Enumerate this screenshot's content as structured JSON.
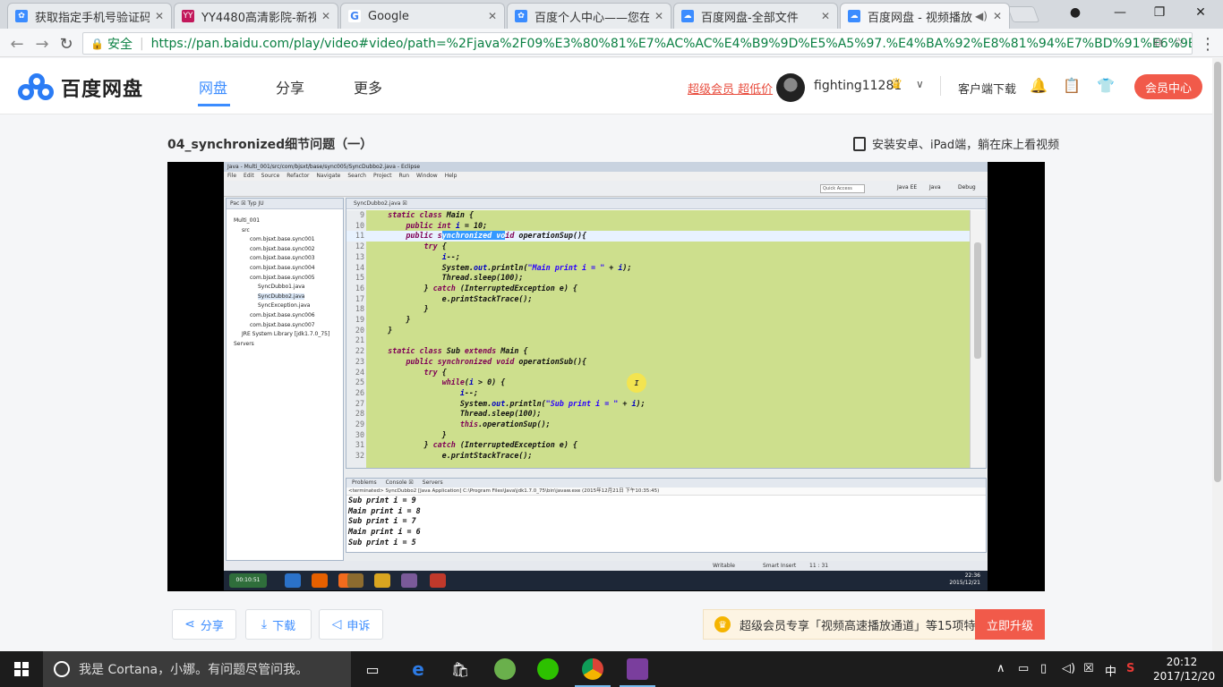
{
  "browser": {
    "tabs": [
      {
        "title": "获取指定手机号验证码",
        "icon_color": "#3b8cff",
        "icon": "baidu-paw-icon"
      },
      {
        "title": "YY4480高清影院-新视",
        "icon_color": "#c2185b",
        "icon": "yy4480-icon"
      },
      {
        "title": "Google",
        "icon_color": "#4285f4",
        "icon": "google-icon"
      },
      {
        "title": "百度个人中心——您在",
        "icon_color": "#3b8cff",
        "icon": "baidu-paw-icon"
      },
      {
        "title": "百度网盘-全部文件",
        "icon_color": "#3b8cff",
        "icon": "baidu-pan-icon"
      },
      {
        "title": "百度网盘 - 视频播放",
        "icon_color": "#3b8cff",
        "icon": "baidu-pan-icon",
        "active": true
      }
    ],
    "secure_label": "安全",
    "url_host": "https://pan.baidu.com",
    "url_rest": "/play/video#video/path=%2Fjava%2F09%E3%80%81%E7%AC%AC%E4%B9%9D%E5%A5%97.%E4%BA%92%E8%81%94%E7%BD%91%E6%9E..."
  },
  "header": {
    "logo_text": "百度网盘",
    "nav": [
      "网盘",
      "分享",
      "更多"
    ],
    "vip_link": "超级会员 超低价",
    "username": "fighting11281",
    "client_download": "客户端下载",
    "vip_center": "会员中心"
  },
  "video": {
    "title": "04_synchronized细节问题（一）",
    "mobile_hint": "安装安卓、iPad端，躺在床上看视频"
  },
  "eclipse": {
    "title_bar": "Java - Multi_001/src/com/bjsxt/base/sync005/SyncDubbo2.java - Eclipse",
    "menu": [
      "File",
      "Edit",
      "Source",
      "Refactor",
      "Navigate",
      "Search",
      "Project",
      "Run",
      "Window",
      "Help"
    ],
    "quick_access": "Quick Access",
    "perspectives": [
      "Java EE",
      "Java",
      "Debug"
    ],
    "pkg_tabs": "Pac ☒  Typ  JU",
    "tree": [
      {
        "label": "Multi_001",
        "indent": 0
      },
      {
        "label": "src",
        "indent": 1
      },
      {
        "label": "com.bjsxt.base.sync001",
        "indent": 2
      },
      {
        "label": "com.bjsxt.base.sync002",
        "indent": 2
      },
      {
        "label": "com.bjsxt.base.sync003",
        "indent": 2
      },
      {
        "label": "com.bjsxt.base.sync004",
        "indent": 2
      },
      {
        "label": "com.bjsxt.base.sync005",
        "indent": 2
      },
      {
        "label": "SyncDubbo1.java",
        "indent": 3
      },
      {
        "label": "SyncDubbo2.java",
        "indent": 3
      },
      {
        "label": "SyncException.java",
        "indent": 3
      },
      {
        "label": "com.bjsxt.base.sync006",
        "indent": 2
      },
      {
        "label": "com.bjsxt.base.sync007",
        "indent": 2
      },
      {
        "label": "JRE System Library [jdk1.7.0_75]",
        "indent": 1
      },
      {
        "label": "Servers",
        "indent": 0
      }
    ],
    "editor_tab": "SyncDubbo2.java ☒",
    "console_tabs": [
      "Problems",
      "Console ☒",
      "Servers"
    ],
    "console_header": "<terminated> SyncDubbo2 [Java Application] C:\\Program Files\\Java\\jdk1.7.0_75\\bin\\javaw.exe (2015年12月21日 下午10:35:45)",
    "console_lines": [
      "Sub print i = 9",
      "Main print i = 8",
      "Sub print i = 7",
      "Main print i = 6",
      "Sub print i = 5"
    ],
    "status": {
      "writable": "Writable",
      "insert": "Smart Insert",
      "pos": "11 : 31"
    },
    "clock_time": "22:36",
    "clock_date": "2015/12/21",
    "taskbar_time": "00:10:51"
  },
  "actions": {
    "share": "分享",
    "download": "下载",
    "report": "申诉",
    "promo": "超级会员专享「视频高速播放通道」等15项特权",
    "upgrade": "立即升级"
  },
  "taskbar": {
    "cortana": "我是 Cortana，小娜。有问题尽管问我。",
    "ime": "中",
    "time": "20:12",
    "date": "2017/12/20"
  }
}
